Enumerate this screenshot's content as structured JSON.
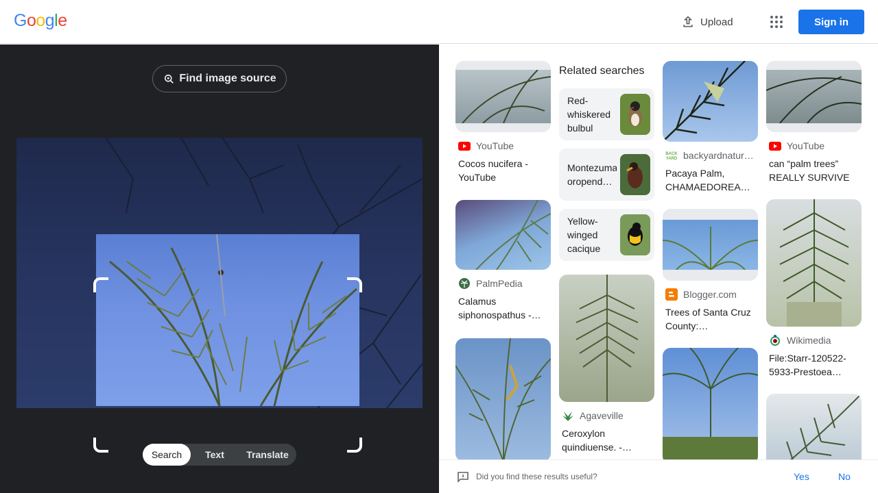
{
  "header": {
    "logo_letters": [
      "G",
      "o",
      "o",
      "g",
      "l",
      "e"
    ],
    "logo_colors": [
      "#4285F4",
      "#EA4335",
      "#FBBC05",
      "#4285F4",
      "#34A853",
      "#EA4335"
    ],
    "upload_label": "Upload",
    "signin_label": "Sign in",
    "accent": "#1a73e8"
  },
  "lens": {
    "find_source_label": "Find image source",
    "modes": [
      "Search",
      "Text",
      "Translate"
    ],
    "active_mode": "Search"
  },
  "results": {
    "related_title": "Related searches",
    "related": [
      {
        "label": "Red-whiskered bulbul"
      },
      {
        "label": "Montezuma oropend…"
      },
      {
        "label": "Yellow-winged cacique"
      }
    ],
    "items": [
      {
        "source": "YouTube",
        "source_icon": "youtube-icon",
        "title": "Cocos nucifera - YouTube"
      },
      {
        "source": "PalmPedia",
        "source_icon": "palmpedia-icon",
        "title": "Calamus siphonospathus -…"
      },
      {
        "source": "",
        "source_icon": "",
        "title": ""
      },
      {
        "source": "Agaveville",
        "source_icon": "agaveville-icon",
        "title": "Ceroxylon quindiuense. -…"
      },
      {
        "source": "backyardnatur…",
        "source_icon": "backyard-icon",
        "title": "Pacaya Palm, CHAMAEDOREA…"
      },
      {
        "source": "Blogger.com",
        "source_icon": "blogger-icon",
        "title": "Trees of Santa Cruz County:…"
      },
      {
        "source": "",
        "source_icon": "",
        "title": ""
      },
      {
        "source": "YouTube",
        "source_icon": "youtube-icon",
        "title": "can “palm trees” REALLY SURVIVE i…"
      },
      {
        "source": "Wikimedia",
        "source_icon": "wikimedia-icon",
        "title": "File:Starr-120522-5933-Prestoea…"
      },
      {
        "source": "",
        "source_icon": "",
        "title": ""
      }
    ]
  },
  "feedback": {
    "question": "Did you find these results useful?",
    "yes_label": "Yes",
    "no_label": "No"
  }
}
